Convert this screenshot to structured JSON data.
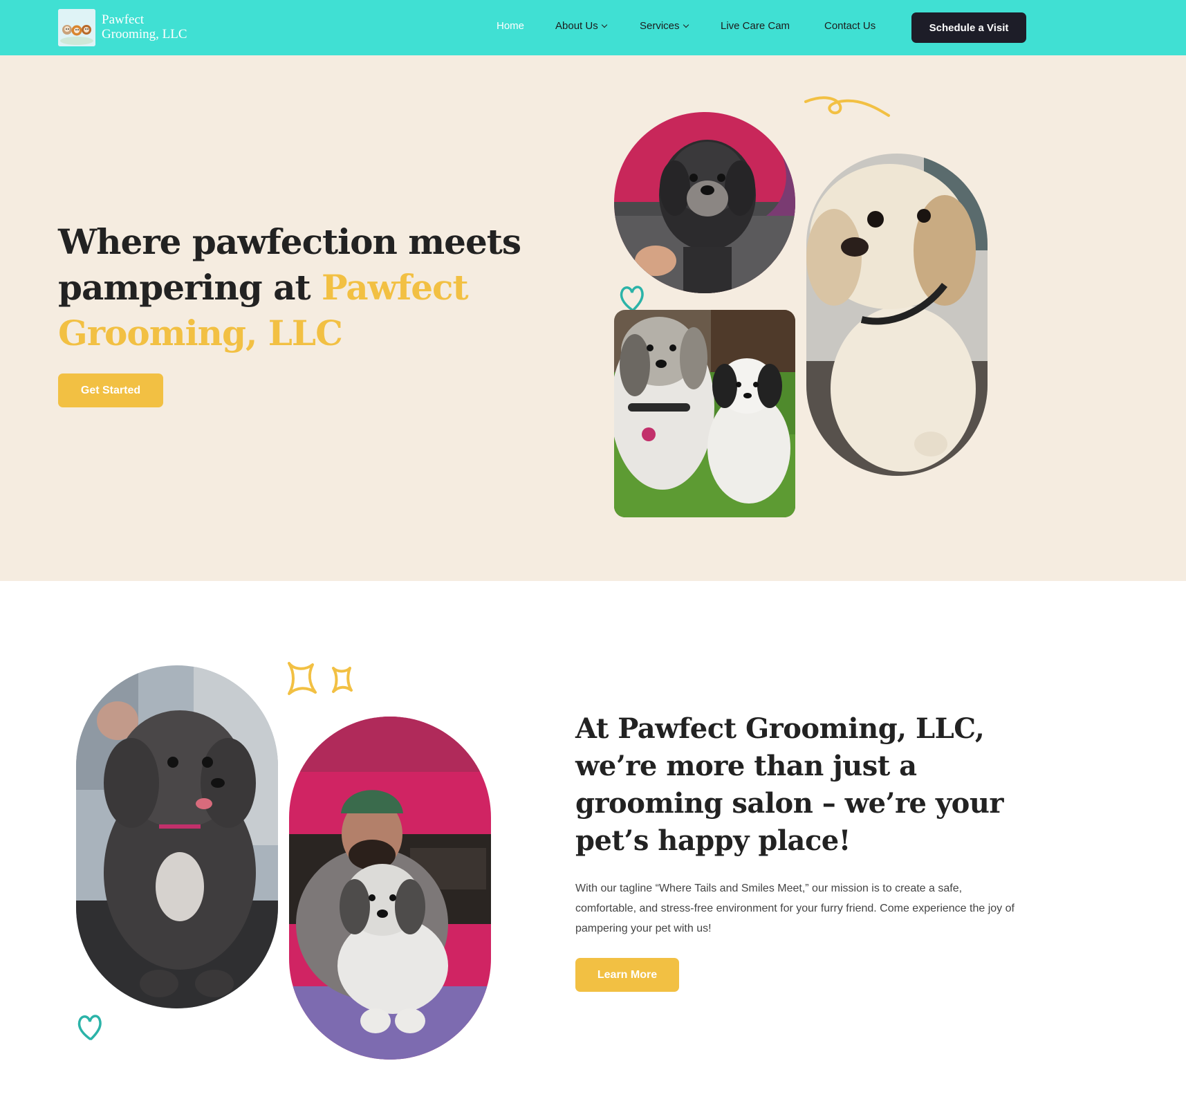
{
  "brand": {
    "name_line1": "Pawfect",
    "name_line2": "Grooming, LLC"
  },
  "nav": {
    "home": "Home",
    "about": "About Us",
    "services": "Services",
    "live_cam": "Live Care Cam",
    "contact": "Contact Us",
    "cta": "Schedule a Visit"
  },
  "hero": {
    "title_part1": "Where pawfection meets pampering at ",
    "title_highlight": "Pawfect Grooming, LLC",
    "button": "Get Started"
  },
  "about": {
    "title": "At Pawfect Grooming, LLC, we’re more than just a grooming salon – we’re your pet’s happy place!",
    "text": "With our tagline “Where Tails and Smiles Meet,” our mission is to create a safe, comfortable, and stress-free environment for your furry friend. Come experience the joy of pampering your pet with us!",
    "button": "Learn More"
  },
  "colors": {
    "nav_bg": "#40e0d3",
    "hero_bg": "#f5ece0",
    "accent_yellow": "#f2c043",
    "dark_button": "#1d1d28",
    "teal_doodle": "#2bb3a8"
  },
  "icons": [
    "chevron-down-icon",
    "heart-doodle-icon",
    "swirl-doodle-icon",
    "sparkle-doodle-icon"
  ]
}
